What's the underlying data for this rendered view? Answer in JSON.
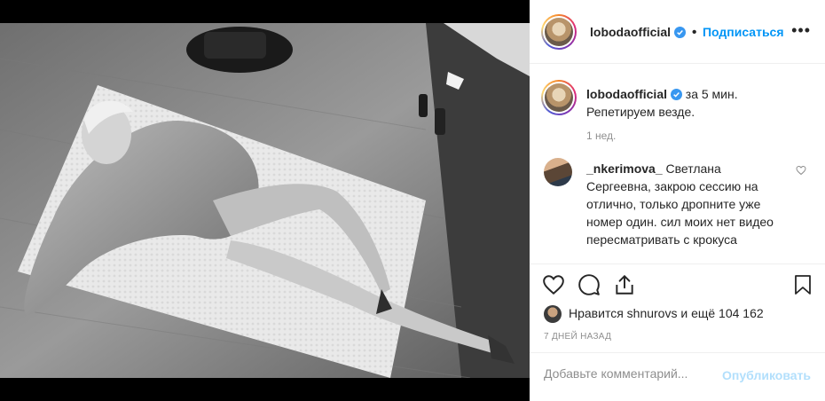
{
  "post": {
    "author": "lobodaofficial",
    "follow_label": "Подписаться",
    "more_label": "•••"
  },
  "caption": {
    "author": "lobodaofficial",
    "text": "за 5 мин. Репетируем везде.",
    "time": "1 нед."
  },
  "comments": [
    {
      "author": "_nkerimova_",
      "text": "Светлана Сергеевна, закрою сессию на отлично, только дропните уже номер один. сил моих нет видео пересматривать с крокуса"
    }
  ],
  "likes": {
    "text": "Нравится shnurovs и ещё 104 162"
  },
  "posted": "7 ДНЕЙ НАЗАД",
  "add_comment": {
    "placeholder": "Добавьте комментарий...",
    "publish_label": "Опубликовать"
  },
  "colors": {
    "link_blue": "#0095f6",
    "publish_disabled": "#b2dffc",
    "muted": "#8e8e8e"
  }
}
